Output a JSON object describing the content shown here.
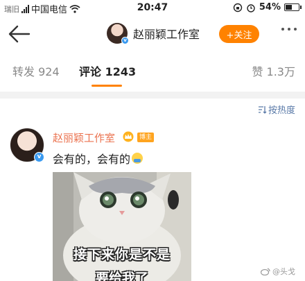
{
  "status_bar": {
    "carrier_prefix": "瑞旧",
    "carrier": "中国电信",
    "time": "20:47",
    "battery": "54%",
    "battery_level": 0.54
  },
  "nav": {
    "title": "赵丽颖工作室",
    "follow_label": "+关注"
  },
  "tabs": [
    {
      "label": "转发 924"
    },
    {
      "label": "评论 1243"
    },
    {
      "label": "赞 1.3万"
    }
  ],
  "sort_label": "按热度",
  "comment": {
    "author": "赵丽颖工作室",
    "author_tag": "博主",
    "text": "会有的，会有的"
  },
  "meme": {
    "line1": "接下来你是不是",
    "line2": "要给我了"
  },
  "watermark": "@头戈",
  "colors": {
    "accent": "#ff8200",
    "name": "#eb7350",
    "link": "#5a7aa8"
  }
}
